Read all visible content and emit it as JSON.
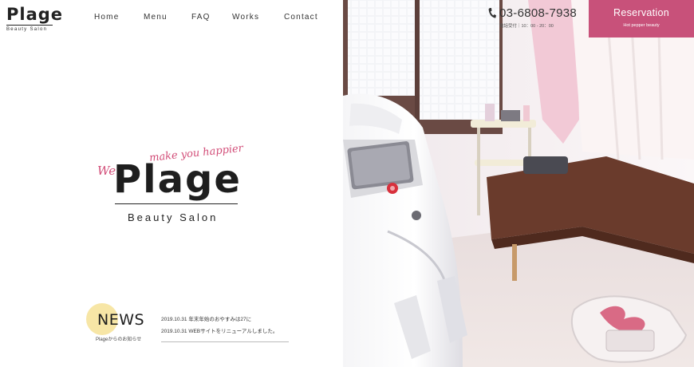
{
  "header": {
    "logo_word": "Plage",
    "logo_sub": "Beauty Salon",
    "nav": [
      "Home",
      "Menu",
      "FAQ",
      "Works",
      "Contact"
    ]
  },
  "hero": {
    "we": "We",
    "tagline": "make you happier",
    "brand": "Plage",
    "subtitle": "Beauty Salon"
  },
  "news": {
    "title": "NEWS",
    "subtitle": "Plageからのお知らせ",
    "items": [
      "2019.10.31 年末年始のおやすみは27に",
      "2019.10.31 WEBサイトをリニューアルしました。"
    ]
  },
  "contact": {
    "phone": "03-6808-7938",
    "hours": "電話受付｜10：00 - 20：00",
    "phone_icon": "phone-icon"
  },
  "reservation": {
    "label": "Reservation",
    "sub": "Hot pepper beauty"
  },
  "colors": {
    "accent": "#c8517a",
    "news_circle": "#f7e6a6",
    "tagline": "#d24d78"
  }
}
